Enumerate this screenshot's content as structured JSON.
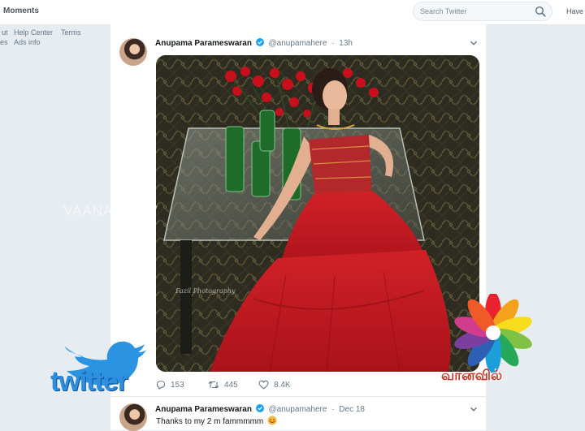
{
  "topbar": {
    "moments_label": "Moments",
    "search_placeholder": "Search Twitter",
    "have_account": "Have"
  },
  "footer": {
    "links": [
      "ut",
      "Help Center",
      "Terms",
      "es",
      "Ads info"
    ]
  },
  "tweets": [
    {
      "name": "Anupama Parameswaran",
      "handle": "@anupamahere",
      "separator": "·",
      "time": "13h",
      "media_watermark": "VAANAVIL TV",
      "photographer_signature": "Fazil Photography",
      "replies": "153",
      "retweets": "445",
      "likes": "8.4K"
    },
    {
      "name": "Anupama Parameswaran",
      "handle": "@anupamahere",
      "separator": "·",
      "time": "Dec 18",
      "text": "Thanks to my 2 m fammmmm"
    }
  ],
  "overlays": {
    "twitter_logo_text": "twitter",
    "channel_logo_text": "வானவில்"
  },
  "colors": {
    "twitter_blue": "#1da1f2",
    "background": "#e6ecf0",
    "dress_red": "#c8191e"
  },
  "icons": [
    "search-icon",
    "verified-badge-icon",
    "chevron-down-icon",
    "reply-icon",
    "retweet-icon",
    "like-icon",
    "smiling-face-emoji-icon"
  ]
}
